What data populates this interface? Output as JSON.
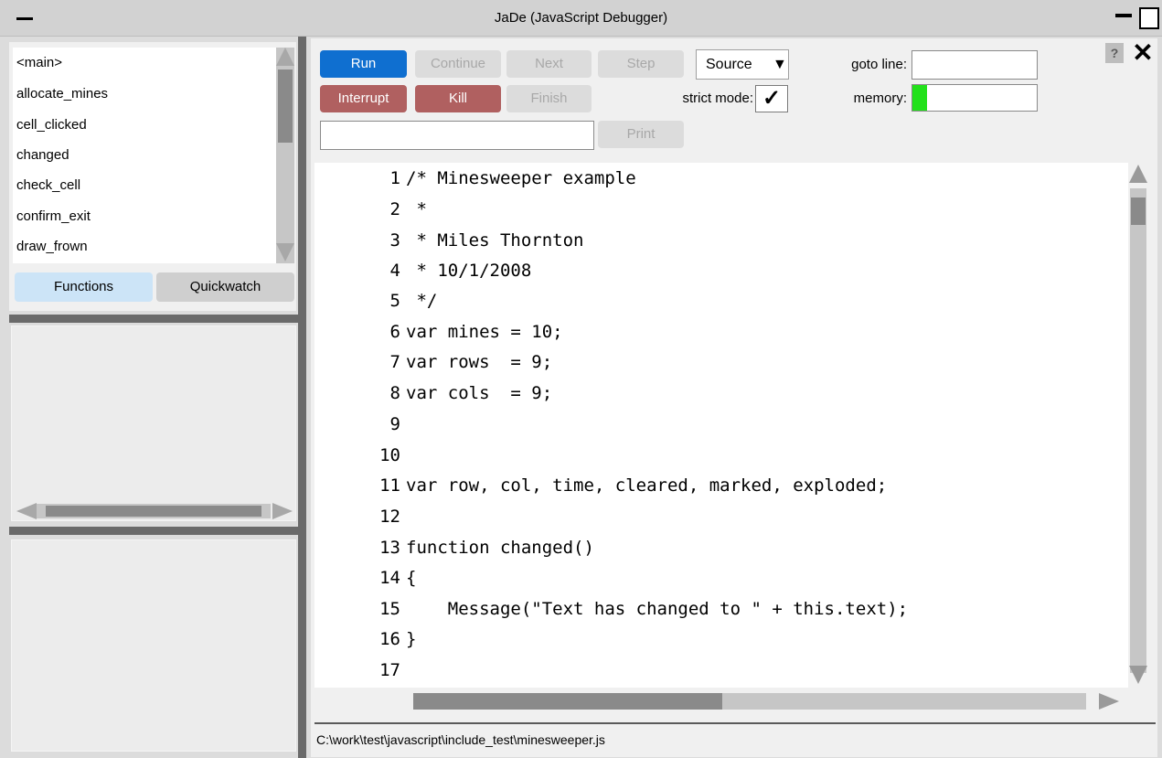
{
  "window": {
    "title": "JaDe (JavaScript Debugger)"
  },
  "functions": {
    "items": [
      "<main>",
      "allocate_mines",
      "cell_clicked",
      "changed",
      "check_cell",
      "confirm_exit",
      "draw_frown"
    ]
  },
  "tabs": {
    "functions": "Functions",
    "quickwatch": "Quickwatch"
  },
  "toolbar": {
    "run": "Run",
    "continue": "Continue",
    "next": "Next",
    "step": "Step",
    "interrupt": "Interrupt",
    "kill": "Kill",
    "finish": "Finish",
    "print": "Print",
    "source_select": "Source",
    "strict_mode_label": "strict mode:",
    "strict_mode_checked": true,
    "goto_label": "goto line:",
    "goto_value": "",
    "memory_label": "memory:",
    "memory_fraction": 0.12,
    "print_value": ""
  },
  "colors": {
    "run_button": "#0f6fd0",
    "kill_button": "#b06060",
    "memory_fill": "#22e11a",
    "tab_active": "#cce4f7"
  },
  "code": {
    "lines": [
      {
        "n": "1",
        "text": "/* Minesweeper example"
      },
      {
        "n": "2",
        "text": " *"
      },
      {
        "n": "3",
        "text": " * Miles Thornton"
      },
      {
        "n": "4",
        "text": " * 10/1/2008"
      },
      {
        "n": "5",
        "text": " */"
      },
      {
        "n": "6",
        "text": "var mines = 10;"
      },
      {
        "n": "7",
        "text": "var rows  = 9;"
      },
      {
        "n": "8",
        "text": "var cols  = 9;"
      },
      {
        "n": "9",
        "text": ""
      },
      {
        "n": "10",
        "text": ""
      },
      {
        "n": "11",
        "text": "var row, col, time, cleared, marked, exploded;"
      },
      {
        "n": "12",
        "text": ""
      },
      {
        "n": "13",
        "text": "function changed()"
      },
      {
        "n": "14",
        "text": "{"
      },
      {
        "n": "15",
        "text": "    Message(\"Text has changed to \" + this.text);"
      },
      {
        "n": "16",
        "text": "}"
      },
      {
        "n": "17",
        "text": ""
      }
    ]
  },
  "status": {
    "file_path": "C:\\work\\test\\javascript\\include_test\\minesweeper.js"
  },
  "icons": {
    "help": "?",
    "close": "✕"
  }
}
